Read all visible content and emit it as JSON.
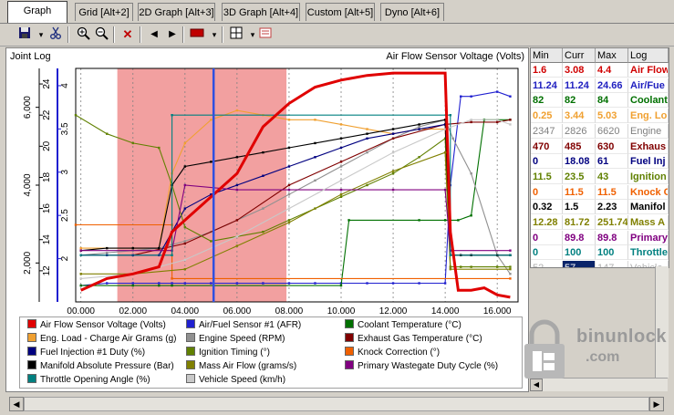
{
  "tabs": [
    {
      "label": "Graph [Alt+1]",
      "active": true
    },
    {
      "label": "Grid [Alt+2]"
    },
    {
      "label": "2D Graph [Alt+3]"
    },
    {
      "label": "3D Graph [Alt+4]"
    },
    {
      "label": "Custom [Alt+5]"
    },
    {
      "label": "Dyno [Alt+6]"
    }
  ],
  "toolbar": {
    "icons": [
      "save-icon",
      "cut-icon",
      "zoom-in-icon",
      "zoom-out-icon",
      "delete-icon",
      "prev-icon",
      "next-icon",
      "color-icon",
      "layout-icon",
      "print-icon"
    ]
  },
  "graph": {
    "log_title": "Joint Log",
    "x_title": "Air Flow Sensor Voltage (Volts)"
  },
  "chart_data": {
    "type": "line",
    "x_ticks": [
      "00.000",
      "02.000",
      "04.000",
      "06.000",
      "08.000",
      "10.000",
      "12.000",
      "14.000",
      "16.000"
    ],
    "xlim": [
      -0.2,
      16.8
    ],
    "selection_range": [
      1.4,
      7.9
    ],
    "cursor_x": 5.1,
    "left_axis_outer": {
      "ticks": [
        "2,000",
        "4,000",
        "6,000"
      ],
      "ylim": [
        1000,
        7000
      ]
    },
    "left_axis_inner": {
      "ticks": [
        "12",
        "14",
        "16",
        "18",
        "20",
        "22",
        "24"
      ],
      "ylim": [
        10,
        25
      ]
    },
    "left_axis_blue": {
      "ticks": [
        "2",
        "2.5",
        "3",
        "3.5",
        "4"
      ],
      "ylim": [
        1.5,
        4.2
      ]
    },
    "series": [
      {
        "name": "Air Flow Sensor Voltage (Volts)",
        "color": "#e00000",
        "x": [
          0,
          1,
          2,
          3,
          3.5,
          4,
          5,
          6,
          7,
          8,
          9,
          10,
          11,
          12,
          13,
          14,
          14.2,
          14.5,
          15,
          15.5,
          16,
          16.5
        ],
        "y": [
          0.05,
          0.1,
          0.12,
          0.15,
          0.3,
          0.35,
          0.45,
          0.55,
          0.75,
          0.85,
          0.92,
          0.95,
          0.97,
          0.98,
          0.98,
          0.98,
          0.3,
          0.05,
          0.05,
          0.06,
          0.03,
          0.02
        ]
      },
      {
        "name": "Air/Fuel Sensor #1 (AFR)",
        "color": "#2020d0",
        "x": [
          0,
          1,
          2,
          3,
          3.5,
          4,
          5,
          6,
          7,
          8,
          9,
          10,
          11,
          12,
          13,
          14,
          14.2,
          14.6,
          15,
          16,
          16.5
        ],
        "y": [
          0.07,
          0.08,
          0.08,
          0.08,
          0.08,
          0.08,
          0.08,
          0.08,
          0.08,
          0.08,
          0.08,
          0.08,
          0.08,
          0.08,
          0.08,
          0.08,
          0.5,
          0.88,
          0.88,
          0.9,
          0.88
        ]
      },
      {
        "name": "Coolant Temperature (°C)",
        "color": "#007000",
        "x": [
          0,
          2,
          3,
          3.5,
          10,
          10.3,
          13,
          14,
          14.5,
          15,
          15.5,
          16,
          16.5
        ],
        "y": [
          0.07,
          0.07,
          0.07,
          0.07,
          0.07,
          0.35,
          0.35,
          0.35,
          0.35,
          0.37,
          0.78,
          0.78,
          0.78
        ]
      },
      {
        "name": "Eng. Load - Charge Air Grams (g)",
        "color": "#f0a030",
        "x": [
          0,
          1,
          2,
          3,
          3.5,
          4,
          5,
          6,
          7,
          8,
          9,
          10,
          11,
          12,
          13,
          14,
          14.2,
          14.6,
          15,
          16,
          16.5
        ],
        "y": [
          0.23,
          0.23,
          0.23,
          0.23,
          0.55,
          0.68,
          0.78,
          0.82,
          0.8,
          0.78,
          0.78,
          0.76,
          0.74,
          0.72,
          0.74,
          0.74,
          0.2,
          0.2,
          0.2,
          0.2,
          0.2
        ]
      },
      {
        "name": "Engine Speed (RPM)",
        "color": "#909090",
        "x": [
          0,
          1,
          2,
          3,
          4,
          5,
          6,
          7,
          8,
          9,
          10,
          11,
          12,
          13,
          14,
          14.3,
          15,
          16,
          16.5
        ],
        "y": [
          0.2,
          0.21,
          0.22,
          0.23,
          0.26,
          0.3,
          0.35,
          0.4,
          0.46,
          0.52,
          0.58,
          0.64,
          0.7,
          0.75,
          0.78,
          0.7,
          0.55,
          0.2,
          0.12
        ]
      },
      {
        "name": "Exhaust Gas Temperature (°C)",
        "color": "#800000",
        "x": [
          0,
          2,
          4,
          6,
          8,
          10,
          12,
          14,
          15,
          16,
          16.5
        ],
        "y": [
          0.2,
          0.2,
          0.25,
          0.35,
          0.5,
          0.6,
          0.7,
          0.76,
          0.77,
          0.77,
          0.78
        ]
      },
      {
        "name": "Fuel Injection #1 Duty (%)",
        "color": "#000080",
        "x": [
          0,
          1,
          2,
          3,
          3.5,
          4,
          5,
          6,
          7,
          8,
          9,
          10,
          11,
          12,
          13,
          14,
          14.2,
          14.6,
          15,
          16,
          16.5
        ],
        "y": [
          0.2,
          0.2,
          0.2,
          0.2,
          0.3,
          0.4,
          0.46,
          0.5,
          0.54,
          0.58,
          0.62,
          0.66,
          0.7,
          0.72,
          0.74,
          0.76,
          0.2,
          0.2,
          0.2,
          0.2,
          0.2
        ]
      },
      {
        "name": "Ignition Timing (°)",
        "color": "#608000",
        "x": [
          -0.2,
          1,
          2,
          3,
          3.5,
          4,
          5,
          6,
          7,
          8,
          9,
          10,
          11,
          12,
          13,
          14,
          14.2,
          14.6,
          15,
          16,
          16.5
        ],
        "y": [
          0.8,
          0.72,
          0.68,
          0.66,
          0.5,
          0.32,
          0.26,
          0.28,
          0.3,
          0.35,
          0.4,
          0.45,
          0.5,
          0.55,
          0.62,
          0.7,
          0.15,
          0.15,
          0.15,
          0.15,
          0.15
        ]
      },
      {
        "name": "Knock Correction (°)",
        "color": "#f06000",
        "x": [
          -0.2,
          3.5,
          3.5,
          16.5
        ],
        "y": [
          0.33,
          0.33,
          0.1,
          0.1
        ]
      },
      {
        "name": "Manifold Absolute Pressure (Bar)",
        "color": "#000000",
        "x": [
          0,
          1,
          2,
          3,
          3.5,
          4,
          5,
          6,
          7,
          8,
          9,
          10,
          11,
          12,
          13,
          14,
          14.2,
          14.6,
          15,
          16,
          16.5
        ],
        "y": [
          0.22,
          0.23,
          0.23,
          0.23,
          0.5,
          0.58,
          0.6,
          0.62,
          0.64,
          0.66,
          0.68,
          0.7,
          0.72,
          0.74,
          0.76,
          0.78,
          0.2,
          0.2,
          0.2,
          0.2,
          0.2
        ]
      },
      {
        "name": "Mass Air Flow (grams/s)",
        "color": "#808000",
        "x": [
          0,
          2,
          4,
          6,
          8,
          10,
          12,
          14,
          14.2,
          16.5
        ],
        "y": [
          0.12,
          0.12,
          0.14,
          0.24,
          0.34,
          0.46,
          0.56,
          0.64,
          0.14,
          0.14
        ]
      },
      {
        "name": "Primary Wastegate Duty Cycle (%)",
        "color": "#800080",
        "x": [
          0,
          3.5,
          4,
          6,
          8,
          10,
          12,
          14,
          14.2,
          16.5
        ],
        "y": [
          0.22,
          0.22,
          0.5,
          0.48,
          0.48,
          0.48,
          0.48,
          0.48,
          0.22,
          0.22
        ]
      },
      {
        "name": "Throttle Opening Angle (%)",
        "color": "#008080",
        "x": [
          0,
          3.5,
          3.5,
          14.2,
          14.2,
          16.5
        ],
        "y": [
          0.2,
          0.2,
          0.8,
          0.8,
          0.2,
          0.2
        ]
      },
      {
        "name": "Vehicle Speed (km/h)",
        "color": "#c8c8c8",
        "x": [
          0,
          2,
          4,
          6,
          8,
          10,
          12,
          14,
          15,
          16,
          16.5
        ],
        "y": [
          0.1,
          0.12,
          0.18,
          0.28,
          0.4,
          0.52,
          0.64,
          0.74,
          0.78,
          0.78,
          0.76
        ]
      }
    ]
  },
  "table": {
    "headers": [
      "Min",
      "Curr",
      "Max",
      "Log"
    ],
    "rows": [
      {
        "min": "1.6",
        "curr": "3.08",
        "max": "4.4",
        "log": "Air Flow",
        "color": "#d00000",
        "bold": true
      },
      {
        "min": "11.24",
        "curr": "11.24",
        "max": "24.66",
        "log": "Air/Fue",
        "color": "#2020c0",
        "bold": true
      },
      {
        "min": "82",
        "curr": "82",
        "max": "84",
        "log": "Coolant",
        "color": "#007000",
        "bold": true
      },
      {
        "min": "0.25",
        "curr": "3.44",
        "max": "5.03",
        "log": "Eng. Lo",
        "color": "#f0a030",
        "bold": true
      },
      {
        "min": "2347",
        "curr": "2826",
        "max": "6620",
        "log": "Engine",
        "color": "#808080",
        "bold": false
      },
      {
        "min": "470",
        "curr": "485",
        "max": "630",
        "log": "Exhaus",
        "color": "#800000",
        "bold": true
      },
      {
        "min": "0",
        "curr": "18.08",
        "max": "61",
        "log": "Fuel Inj",
        "color": "#000080",
        "bold": true
      },
      {
        "min": "11.5",
        "curr": "23.5",
        "max": "43",
        "log": "Ignition",
        "color": "#608000",
        "bold": true
      },
      {
        "min": "0",
        "curr": "11.5",
        "max": "11.5",
        "log": "Knock C",
        "color": "#f06000",
        "bold": true
      },
      {
        "min": "0.32",
        "curr": "1.5",
        "max": "2.23",
        "log": "Manifol",
        "color": "#000000",
        "bold": true
      },
      {
        "min": "12.28",
        "curr": "81.72",
        "max": "251.74",
        "log": "Mass A",
        "color": "#808000",
        "bold": true
      },
      {
        "min": "0",
        "curr": "89.8",
        "max": "89.8",
        "log": "Primary",
        "color": "#800080",
        "bold": true
      },
      {
        "min": "0",
        "curr": "100",
        "max": "100",
        "log": "Throttle",
        "color": "#008080",
        "bold": true
      },
      {
        "min": "52",
        "curr": "57",
        "max": "147",
        "log": "Vehicle",
        "color": "#b0b0b0",
        "bold": false,
        "selected": true
      }
    ]
  },
  "watermark": {
    "line1": "binunlock",
    "line2": ".com"
  }
}
